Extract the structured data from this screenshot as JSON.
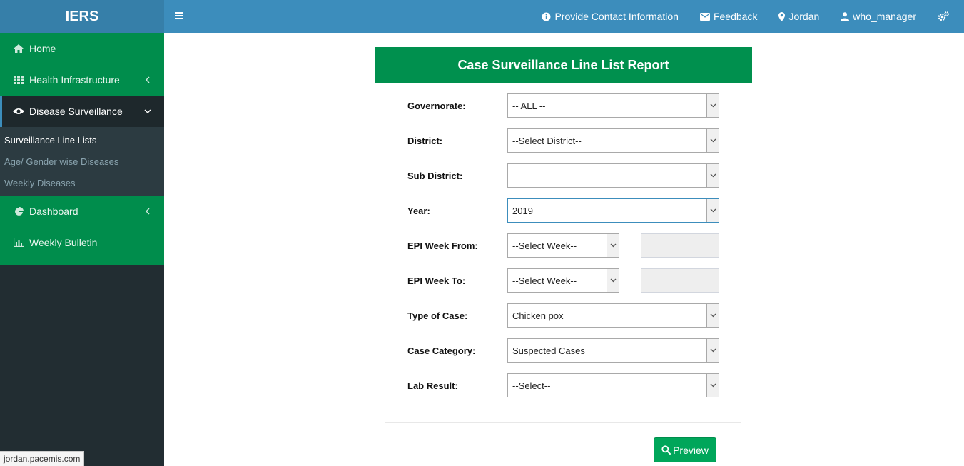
{
  "app": {
    "brand": "IERS"
  },
  "header": {
    "links": [
      {
        "label": "Provide Contact Information",
        "icon": "info-circle-icon"
      },
      {
        "label": "Feedback",
        "icon": "envelope-icon"
      },
      {
        "label": "Jordan",
        "icon": "map-marker-icon"
      },
      {
        "label": "who_manager",
        "icon": "user-icon"
      }
    ],
    "settings_icon": "cogs-icon"
  },
  "sidebar": {
    "items": [
      {
        "label": "Home",
        "icon": "home-icon"
      },
      {
        "label": "Health Infrastructure",
        "icon": "grid-icon"
      },
      {
        "label": "Disease Surveillance",
        "icon": "eye-icon"
      },
      {
        "label": "Dashboard",
        "icon": "pie-chart-icon"
      },
      {
        "label": "Weekly Bulletin",
        "icon": "bar-chart-icon"
      }
    ],
    "submenu": [
      {
        "label": "Surveillance Line Lists"
      },
      {
        "label": "Age/ Gender wise Diseases"
      },
      {
        "label": "Weekly Diseases"
      }
    ]
  },
  "status_bar": {
    "url": "jordan.pacemis.com"
  },
  "report": {
    "title": "Case Surveillance Line List Report",
    "fields": {
      "governorate": {
        "label": "Governorate:",
        "value": "-- ALL --"
      },
      "district": {
        "label": "District:",
        "value": "--Select District--"
      },
      "sub_district": {
        "label": "Sub District:",
        "value": ""
      },
      "year": {
        "label": "Year:",
        "value": "2019"
      },
      "epi_week_from": {
        "label": "EPI Week From:",
        "value": "--Select Week--"
      },
      "epi_week_to": {
        "label": "EPI Week To:",
        "value": "--Select Week--"
      },
      "type_of_case": {
        "label": "Type of Case:",
        "value": "Chicken pox"
      },
      "case_category": {
        "label": "Case Category:",
        "value": "Suspected Cases"
      },
      "lab_result": {
        "label": "Lab Result:",
        "value": "--Select--"
      }
    },
    "preview_label": "Preview"
  },
  "colors": {
    "header_blue": "#3c8dbc",
    "brand_blue": "#367fa9",
    "sidebar_green": "#008d4c",
    "sidebar_dark": "#222d32",
    "title_green": "#00904e",
    "button_green": "#00a65a"
  }
}
